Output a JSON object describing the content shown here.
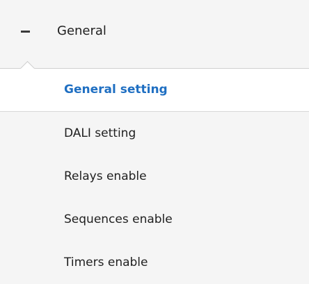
{
  "group": {
    "label": "General",
    "expanded_icon": "minus-icon"
  },
  "items": [
    {
      "label": "General setting",
      "active": true
    },
    {
      "label": "DALI setting",
      "active": false
    },
    {
      "label": "Relays enable",
      "active": false
    },
    {
      "label": "Sequences enable",
      "active": false
    },
    {
      "label": "Timers enable",
      "active": false
    }
  ],
  "colors": {
    "active_text": "#1f6fc2",
    "background": "#f5f5f5",
    "active_background": "#ffffff"
  }
}
